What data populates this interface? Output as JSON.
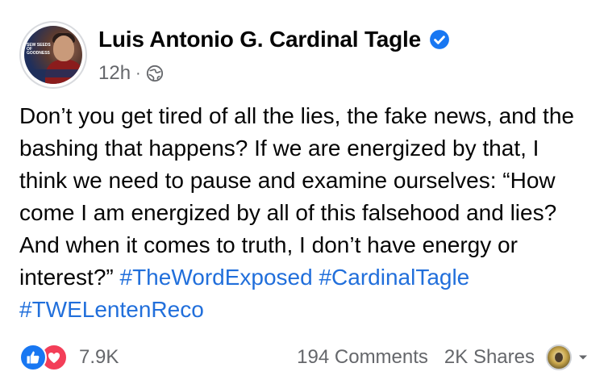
{
  "post": {
    "author": "Luis Antonio G. Cardinal Tagle",
    "verified": true,
    "time": "12h",
    "separator": "·",
    "audience_icon": "globe-icon",
    "avatar_overlay_text": "SEW SEEDS OF GOODNESS",
    "text_lines": [
      "Don’t you get tired of all the lies, the fake news,",
      "and the bashing that happens? If we are energized",
      "by that, I think we need to pause and examine",
      "ourselves: “How come I am energized by all of this",
      "falsehood and lies? And when it comes to truth, I",
      "don’t have energy or interest?” "
    ],
    "hashtags": [
      "#TheWordExposed",
      "#CardinalTagle",
      "#TWELentenReco"
    ]
  },
  "footer": {
    "reaction_icons": [
      "like-icon",
      "love-icon"
    ],
    "reaction_count": "7.9K",
    "comments": "194 Comments",
    "shares": "2K Shares"
  },
  "colors": {
    "hashtag": "#216fdb",
    "like": "#1877f2",
    "love": "#f33e58",
    "verified": "#1877f2",
    "meta": "#65676b"
  }
}
